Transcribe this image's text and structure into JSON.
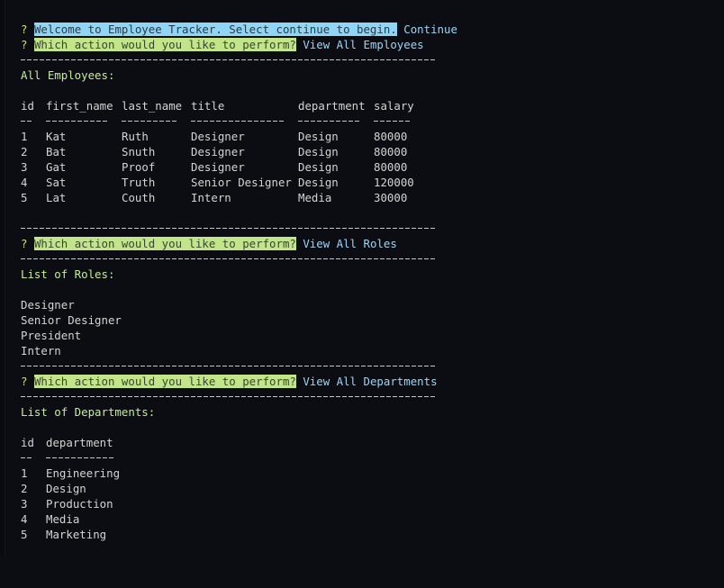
{
  "colors": {
    "background": "#0c0d12",
    "text": "#d4d4d4",
    "question_mark": "#c6e07a",
    "welcome_highlight": "#8fd6f6",
    "prompt_highlight": "#c2e58a",
    "answer": "#9bd4f5",
    "section_header": "#c6ec9a"
  },
  "prompts": {
    "marker": "?",
    "welcome": {
      "question": "Welcome to Employee Tracker. Select continue to begin.",
      "answer": "Continue"
    },
    "action_question": "Which action would you like to perform?",
    "answers": [
      "View All Employees",
      "View All Roles",
      "View All Departments"
    ]
  },
  "employees": {
    "header": "All Employees:",
    "columns": [
      "id",
      "first_name",
      "last_name",
      "title",
      "department",
      "salary"
    ],
    "rows": [
      [
        "1",
        "Kat",
        "Ruth",
        "Designer",
        "Design",
        "80000"
      ],
      [
        "2",
        "Bat",
        "Snuth",
        "Designer",
        "Design",
        "80000"
      ],
      [
        "3",
        "Gat",
        "Proof",
        "Designer",
        "Design",
        "80000"
      ],
      [
        "4",
        "Sat",
        "Truth",
        "Senior Designer",
        "Design",
        "120000"
      ],
      [
        "5",
        "Lat",
        "Couth",
        "Intern",
        "Media",
        "30000"
      ]
    ]
  },
  "roles": {
    "header": "List of Roles:",
    "items": [
      "Designer",
      "Senior Designer",
      "President",
      "Intern"
    ]
  },
  "departments": {
    "header": "List of Departments:",
    "columns": [
      "id",
      "department"
    ],
    "rows": [
      [
        "1",
        "Engineering"
      ],
      [
        "2",
        "Design"
      ],
      [
        "3",
        "Production"
      ],
      [
        "4",
        "Media"
      ],
      [
        "5",
        "Marketing"
      ]
    ]
  }
}
